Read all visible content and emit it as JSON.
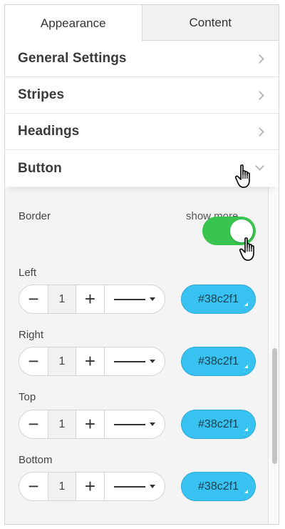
{
  "tabs": [
    {
      "label": "Appearance",
      "active": true
    },
    {
      "label": "Content",
      "active": false
    }
  ],
  "sections": [
    {
      "label": "General Settings",
      "icon": "chevron-right-icon"
    },
    {
      "label": "Stripes",
      "icon": "chevron-right-icon"
    },
    {
      "label": "Headings",
      "icon": "chevron-right-icon"
    },
    {
      "label": "Button",
      "icon": "chevron-down-icon",
      "expanded": true
    }
  ],
  "border": {
    "title": "Border",
    "show_more_label": "show more",
    "show_more_enabled": true,
    "toggle_color": "#39c44f",
    "sides": [
      {
        "label": "Left",
        "minus": "−",
        "value": "1",
        "plus": "+",
        "color": "#38c2f1"
      },
      {
        "label": "Right",
        "minus": "−",
        "value": "1",
        "plus": "+",
        "color": "#38c2f1"
      },
      {
        "label": "Top",
        "minus": "−",
        "value": "1",
        "plus": "+",
        "color": "#38c2f1"
      },
      {
        "label": "Bottom",
        "minus": "−",
        "value": "1",
        "plus": "+",
        "color": "#38c2f1"
      }
    ]
  }
}
